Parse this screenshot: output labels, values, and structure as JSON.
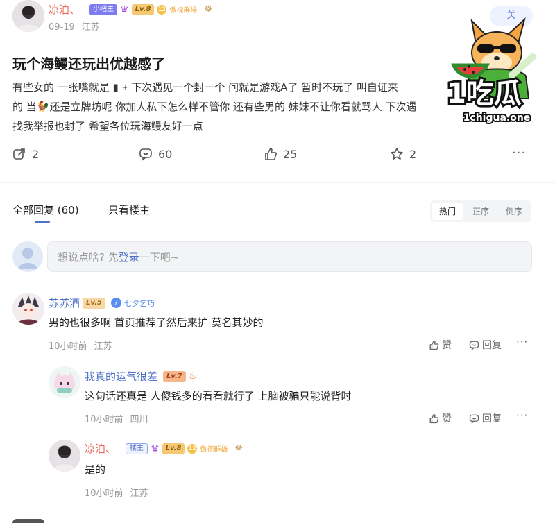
{
  "post": {
    "author": "凉泊、",
    "badges": {
      "owner": "小吧主",
      "level": "Lv.8",
      "tag": "傲视群雄"
    },
    "date": "09-19",
    "location": "江苏",
    "title": "玩个海鳗还玩出优越感了",
    "lines": [
      "有些女的 一张嘴就是 ▮ ⍖ 下次遇见一个封一个 问就是游戏A了 暂时不玩了 叫自证来",
      "的 当🐓还是立牌坊呢 你加人私下怎么样不管你 还有些男的 妹妹不让你看就骂人 下次遇",
      "找我举报也封了 希望各位玩海鳗友好一点"
    ],
    "follow_label": "关",
    "stats": {
      "shares": "2",
      "comments": "60",
      "likes": "25",
      "stars": "2"
    }
  },
  "watermark": {
    "brand": "1吃瓜",
    "url": "1chigua.one"
  },
  "tabs": {
    "all": "全部回复 (60)",
    "owner_only": "只看楼主"
  },
  "sort": {
    "hot": "热门",
    "asc": "正序",
    "desc": "倒序"
  },
  "reply_input": {
    "prefix": "想说点啥? 先",
    "login": "登录",
    "suffix": "一下吧~"
  },
  "comments": [
    {
      "author": "苏苏酒",
      "level": "Lv.5",
      "tag_num": "7",
      "tag": "七夕乞巧",
      "text": "男的也很多啊 首页推荐了然后来扩 莫名其妙的",
      "time": "10小时前",
      "location": "江苏",
      "like_label": "赞",
      "reply_label": "回复"
    },
    {
      "author": "我真的运气很差",
      "level": "Lv.7",
      "text": "这句话还真是 人傻钱多的看看就行了 上脑被骗只能说背时",
      "time": "10小时前",
      "location": "四川",
      "like_label": "赞",
      "reply_label": "回复"
    },
    {
      "author": "凉泊、",
      "host": "楼主",
      "level": "Lv.8",
      "tag": "傲视群雄",
      "text": "是的",
      "time": "10小时前",
      "location": "江苏"
    }
  ],
  "colors": {
    "accent": "#4f73c7",
    "author": "#ef6a5c"
  }
}
